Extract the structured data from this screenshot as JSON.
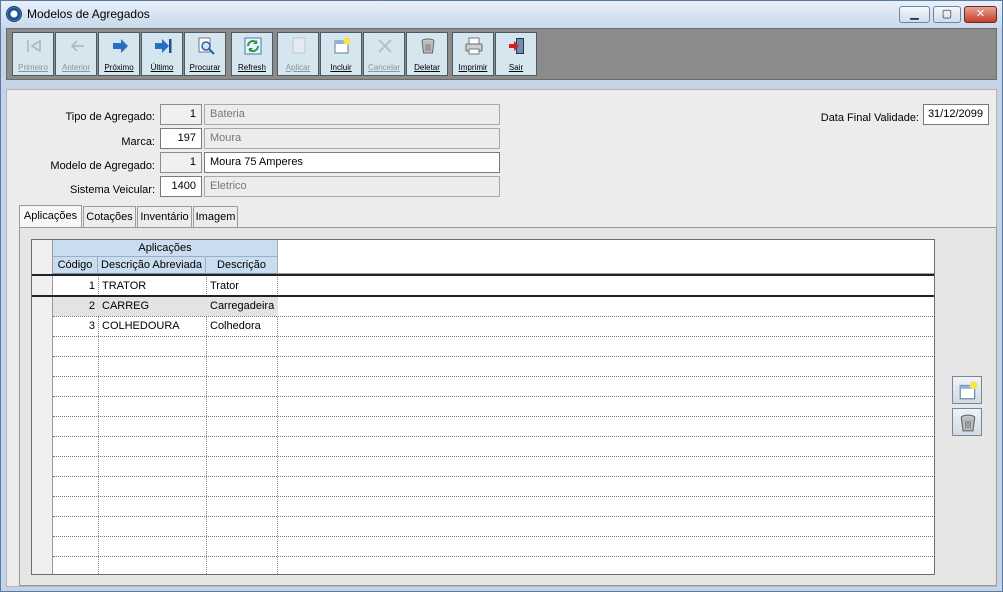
{
  "window": {
    "title": "Modelos de Agregados",
    "controls": {
      "minimize": "▁",
      "maximize": "▢",
      "close": "✕"
    }
  },
  "toolbar": {
    "buttons": [
      {
        "label": "Primeiro",
        "icon": "first-record-icon",
        "enabled": false
      },
      {
        "label": "Anterior",
        "icon": "previous-record-icon",
        "enabled": false
      },
      {
        "label": "Próximo",
        "icon": "next-record-icon",
        "enabled": true
      },
      {
        "label": "Último",
        "icon": "last-record-icon",
        "enabled": true
      },
      {
        "label": "Procurar",
        "icon": "search-icon",
        "enabled": true
      },
      {
        "label": "Refresh",
        "icon": "refresh-icon",
        "enabled": true
      },
      {
        "label": "Aplicar",
        "icon": "apply-icon",
        "enabled": false
      },
      {
        "label": "Incluir",
        "icon": "add-record-icon",
        "enabled": true
      },
      {
        "label": "Cancelar",
        "icon": "cancel-icon",
        "enabled": false
      },
      {
        "label": "Deletar",
        "icon": "trash-icon",
        "enabled": true
      },
      {
        "label": "Imprimir",
        "icon": "printer-icon",
        "enabled": true
      },
      {
        "label": "Sair",
        "icon": "exit-door-icon",
        "enabled": true
      }
    ]
  },
  "form": {
    "tipo_agregado": {
      "label": "Tipo de Agregado:",
      "code": "1",
      "desc": "Bateria"
    },
    "marca": {
      "label": "Marca:",
      "code": "197",
      "desc": "Moura"
    },
    "modelo": {
      "label": "Modelo de Agregado:",
      "code": "1",
      "desc": "Moura 75 Amperes"
    },
    "sistema": {
      "label": "Sistema Veicular:",
      "code": "1400",
      "desc": "Eletrico"
    },
    "data_final": {
      "label": "Data Final Validade:",
      "value": "31/12/2099"
    }
  },
  "tabs": [
    {
      "label": "Aplicações",
      "active": true
    },
    {
      "label": "Cotações",
      "active": false
    },
    {
      "label": "Inventário",
      "active": false
    },
    {
      "label": "Imagem",
      "active": false
    }
  ],
  "grid": {
    "group_header": "Aplicações",
    "columns": [
      "Código",
      "Descrição Abreviada",
      "Descrição"
    ],
    "rows": [
      [
        "1",
        "TRATOR",
        "Trator"
      ],
      [
        "2",
        "CARREG",
        "Carregadeira"
      ],
      [
        "3",
        "COLHEDOURA",
        "Colhedora"
      ]
    ],
    "selected_row": 2
  },
  "side_buttons": {
    "add_icon": "add-record-icon",
    "delete_icon": "trash-icon"
  },
  "colors": {
    "toolbar_bg": "#8b8b8b",
    "button_bg": "#d6e6ef",
    "grid_header": "#c9dcf0"
  }
}
